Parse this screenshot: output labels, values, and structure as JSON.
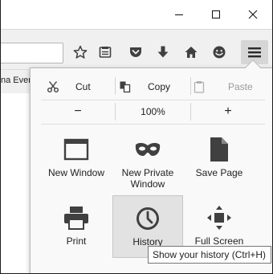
{
  "colors": {
    "toolbar_bg": "#f0f0f0",
    "panel_bg": "#f9f9f9",
    "icon_gray": "#404040",
    "hover_bg": "#e2e2e2",
    "menu_button_bg": "#d6d6d6"
  },
  "window": {
    "controls": [
      "minimize-icon",
      "maximize-icon",
      "close-icon"
    ]
  },
  "toolbar": {
    "icons": [
      "bookmark-star-icon",
      "reading-list-icon",
      "pocket-icon",
      "download-icon",
      "home-icon",
      "hello-icon"
    ],
    "menu_icon": "hamburger-menu-icon"
  },
  "bookmarks": {
    "visible_item": "na Even"
  },
  "menu": {
    "edit": {
      "cut": "Cut",
      "copy": "Copy",
      "paste": "Paste"
    },
    "zoom": {
      "out": "−",
      "level": "100%",
      "in": "+"
    },
    "items": [
      {
        "label": "New Window",
        "icon": "new-window-icon"
      },
      {
        "label": "New Private Window",
        "icon": "private-mask-icon"
      },
      {
        "label": "Save Page",
        "icon": "save-page-icon"
      },
      {
        "label": "Print",
        "icon": "printer-icon"
      },
      {
        "label": "History",
        "icon": "history-clock-icon"
      },
      {
        "label": "Full Screen",
        "icon": "full-screen-icon"
      }
    ]
  },
  "tooltip": {
    "text": "Show your history (Ctrl+H)"
  }
}
